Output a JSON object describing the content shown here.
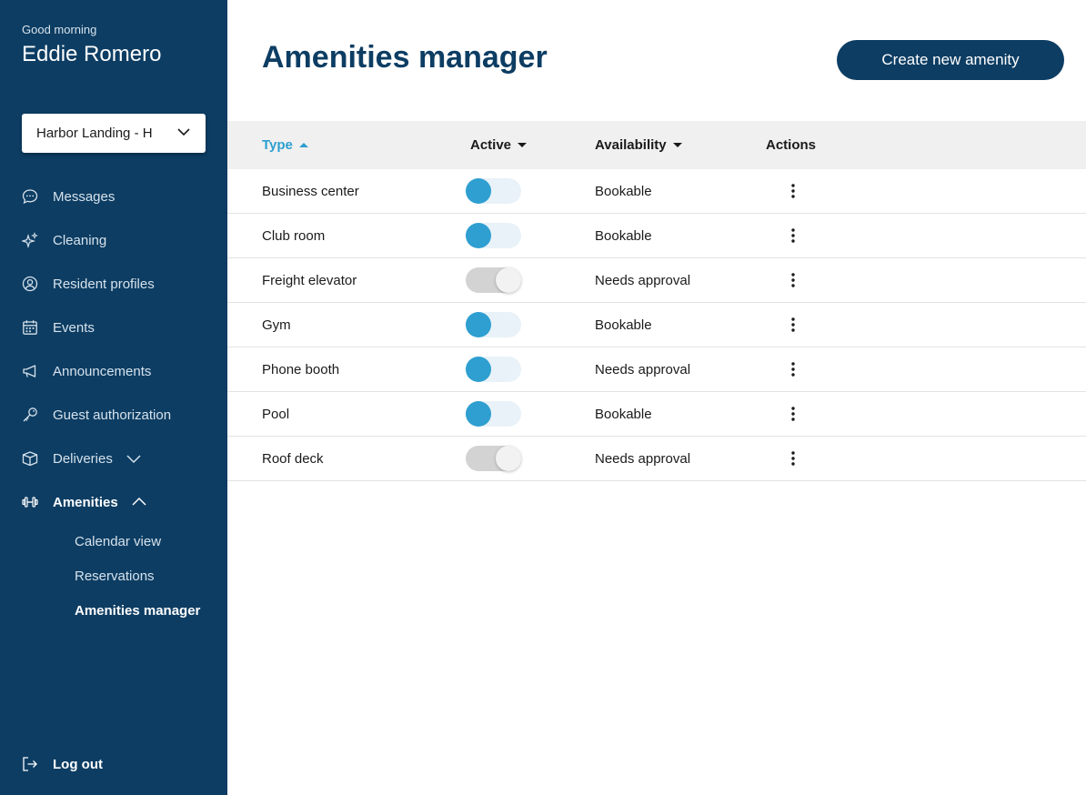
{
  "sidebar": {
    "greeting": "Good morning",
    "user_name": "Eddie Romero",
    "property_select": "Harbor Landing - H",
    "items": [
      {
        "label": "Messages",
        "icon": "message-icon"
      },
      {
        "label": "Cleaning",
        "icon": "sparkle-icon"
      },
      {
        "label": "Resident profiles",
        "icon": "user-circle-icon"
      },
      {
        "label": "Events",
        "icon": "calendar-icon"
      },
      {
        "label": "Announcements",
        "icon": "megaphone-icon"
      },
      {
        "label": "Guest authorization",
        "icon": "key-icon"
      },
      {
        "label": "Deliveries",
        "icon": "box-icon"
      },
      {
        "label": "Amenities",
        "icon": "dumbbell-icon"
      }
    ],
    "amenities_sub": [
      {
        "label": "Calendar view"
      },
      {
        "label": "Reservations"
      },
      {
        "label": "Amenities manager"
      }
    ],
    "logout": "Log out"
  },
  "main": {
    "title": "Amenities manager",
    "create_button": "Create new amenity",
    "columns": {
      "type": "Type",
      "active": "Active",
      "availability": "Availability",
      "actions": "Actions"
    },
    "rows": [
      {
        "type": "Business center",
        "active": true,
        "availability": "Bookable"
      },
      {
        "type": "Club room",
        "active": true,
        "availability": "Bookable"
      },
      {
        "type": "Freight elevator",
        "active": false,
        "availability": "Needs approval"
      },
      {
        "type": "Gym",
        "active": true,
        "availability": "Bookable"
      },
      {
        "type": "Phone booth",
        "active": true,
        "availability": "Needs approval"
      },
      {
        "type": "Pool",
        "active": true,
        "availability": "Bookable"
      },
      {
        "type": "Roof deck",
        "active": false,
        "availability": "Needs approval"
      }
    ]
  },
  "colors": {
    "sidebar_bg": "#0d3d63",
    "accent": "#2e9fd0",
    "header_bg": "#f0f0f0"
  }
}
